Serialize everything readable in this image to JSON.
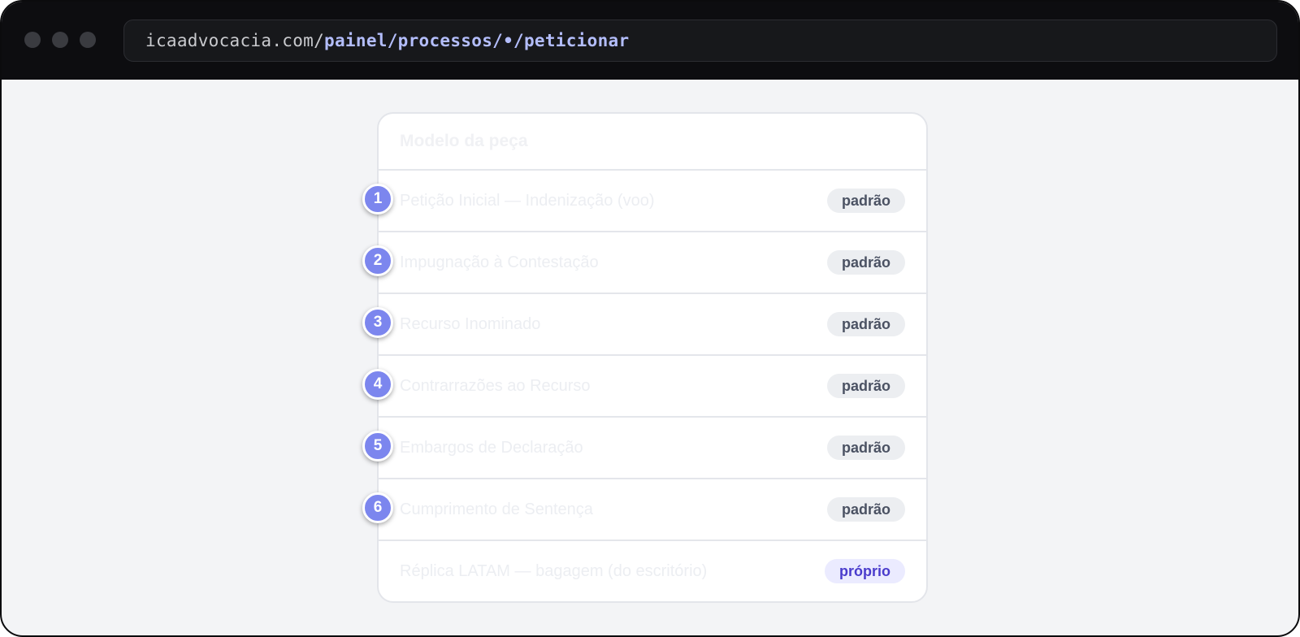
{
  "browser": {
    "url_host": "icaadvocacia.com/",
    "url_path": "painel/processos/•/peticionar"
  },
  "card": {
    "title": "Modelo da peça",
    "items": [
      {
        "label": "Petição Inicial — Indenização (voo)",
        "badge": "padrão"
      },
      {
        "label": "Impugnação à Contestação",
        "badge": "padrão"
      },
      {
        "label": "Recurso Inominado",
        "badge": "padrão"
      },
      {
        "label": "Contrarrazões ao Recurso",
        "badge": "padrão"
      },
      {
        "label": "Embargos de Declaração",
        "badge": "padrão"
      },
      {
        "label": "Cumprimento de Sentença",
        "badge": "padrão"
      },
      {
        "label": "Réplica LATAM — bagagem (do escritório)",
        "badge": "próprio"
      }
    ]
  },
  "markers": [
    "1",
    "2",
    "3",
    "4",
    "5",
    "6"
  ],
  "colors": {
    "marker": "#7c86ee",
    "badge_standard_bg": "#eceef1",
    "badge_own_bg": "#ebebff",
    "badge_own_text": "#4a3ccc"
  }
}
